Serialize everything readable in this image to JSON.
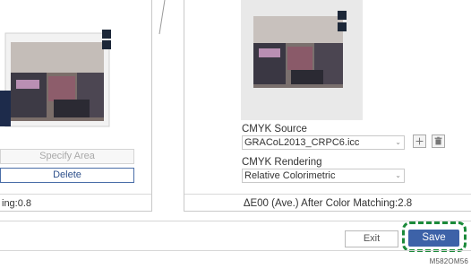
{
  "left_panel": {
    "specify_area_label": "Specify Area",
    "delete_label": "Delete",
    "status_text": "ing:0.8"
  },
  "right_panel": {
    "cmyk_source_label": "CMYK Source",
    "cmyk_source_value": "GRACoL2013_CRPC6.icc",
    "cmyk_rendering_label": "CMYK Rendering",
    "cmyk_rendering_value": "Relative Colorimetric",
    "status_text": "ΔE00 (Ave.) After Color Matching:2.8"
  },
  "footer": {
    "exit_label": "Exit",
    "save_label": "Save",
    "figure_id": "M582OM56"
  },
  "colors": {
    "accent": "#3d62a8",
    "highlight": "#1b8a3a"
  },
  "icons": {
    "add": "plus-icon",
    "delete": "trash-icon",
    "dropdown": "chevron-down-icon"
  }
}
